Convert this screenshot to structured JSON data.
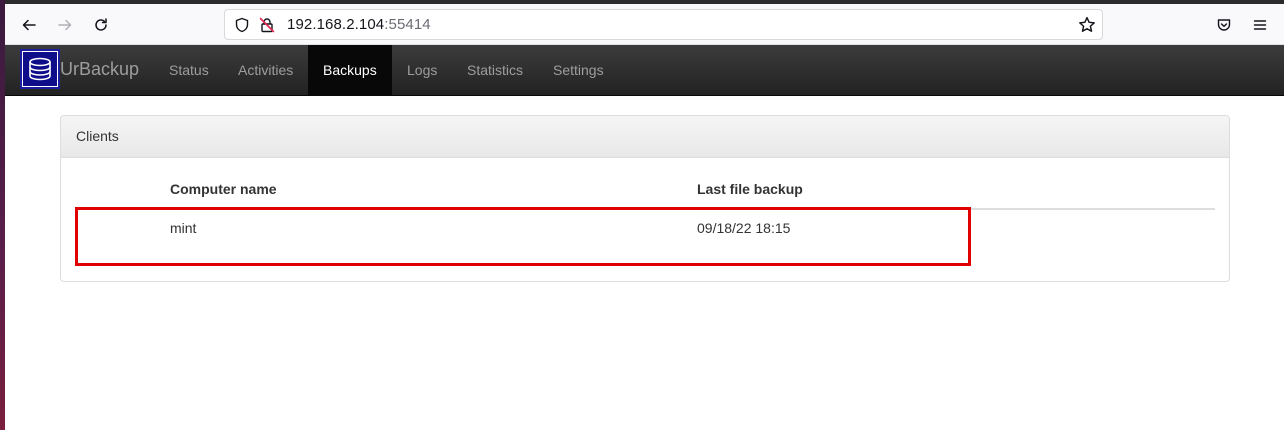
{
  "browser": {
    "url_host": "192.168.2.104",
    "url_port": ":55414"
  },
  "app": {
    "brand": "UrBackup",
    "nav": [
      {
        "label": "Status",
        "active": false
      },
      {
        "label": "Activities",
        "active": false
      },
      {
        "label": "Backups",
        "active": true
      },
      {
        "label": "Logs",
        "active": false
      },
      {
        "label": "Statistics",
        "active": false
      },
      {
        "label": "Settings",
        "active": false
      }
    ]
  },
  "panel": {
    "title": "Clients",
    "columns": [
      "Computer name",
      "Last file backup"
    ],
    "rows": [
      {
        "computer_name": "mint",
        "last_file_backup": "09/18/22 18:15"
      }
    ]
  },
  "colors": {
    "highlight": "#e00000",
    "navbar": "#222222",
    "active_nav": "#080808"
  }
}
